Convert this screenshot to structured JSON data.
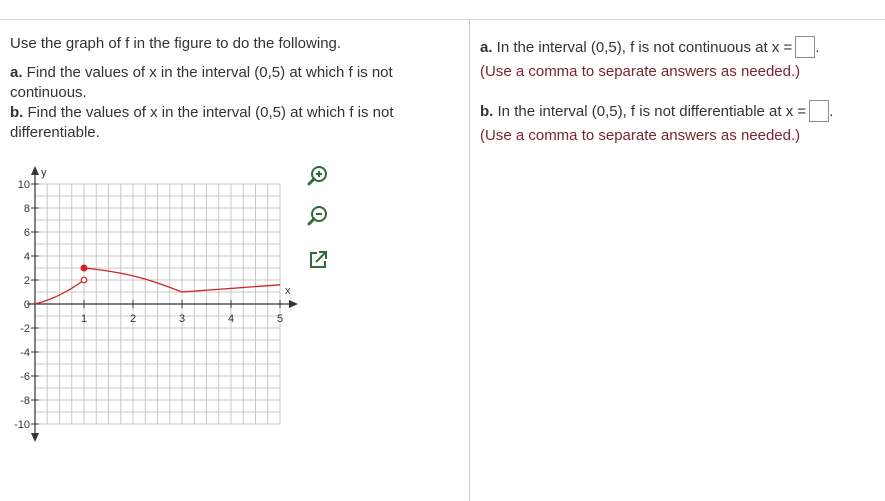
{
  "instructions": {
    "intro": "Use the graph of f in the figure to do the following.",
    "part_a_label": "a.",
    "part_a_text": " Find the values of x in the interval (0,5) at which f is not continuous.",
    "part_b_label": "b.",
    "part_b_text": " Find the values of x in the interval (0,5) at which f is not differentiable."
  },
  "answers": {
    "a_label": "a.",
    "a_text": " In the interval (0,5), f is not continuous at x =",
    "a_hint": "(Use a comma to separate answers as needed.)",
    "a_value": "",
    "b_label": "b.",
    "b_text": " In the interval (0,5), f is not differentiable at x =",
    "b_hint": "(Use a comma to separate answers as needed.)",
    "b_value": "",
    "period": "."
  },
  "graph": {
    "x_axis_label": "x",
    "y_axis_label": "y",
    "x_tick_labels": [
      "1",
      "2",
      "3",
      "4",
      "5"
    ],
    "y_tick_labels": [
      "10",
      "8",
      "6",
      "4",
      "2",
      "0",
      "-2",
      "-4",
      "-6",
      "-8",
      "-10"
    ],
    "x_range": [
      0,
      5
    ],
    "y_range": [
      -10,
      10
    ],
    "curve_color": "#d42020",
    "tools": [
      "zoom-in-icon",
      "zoom-out-icon",
      "open-new-window-icon"
    ]
  },
  "chart_data": {
    "type": "line",
    "series": [
      {
        "values": [
          [
            0,
            0
          ],
          [
            0.5,
            0.5
          ],
          [
            1,
            2
          ]
        ],
        "end": "open"
      },
      {
        "values": [
          [
            1,
            3
          ],
          [
            2,
            2.6
          ],
          [
            2.5,
            1.8
          ],
          [
            3,
            1
          ]
        ],
        "start": "closed"
      },
      {
        "values": [
          [
            3,
            1
          ],
          [
            4,
            1.3
          ],
          [
            5,
            1.6
          ]
        ]
      }
    ],
    "xlim": [
      0,
      5
    ],
    "ylim": [
      -10,
      10
    ],
    "grid": true
  }
}
